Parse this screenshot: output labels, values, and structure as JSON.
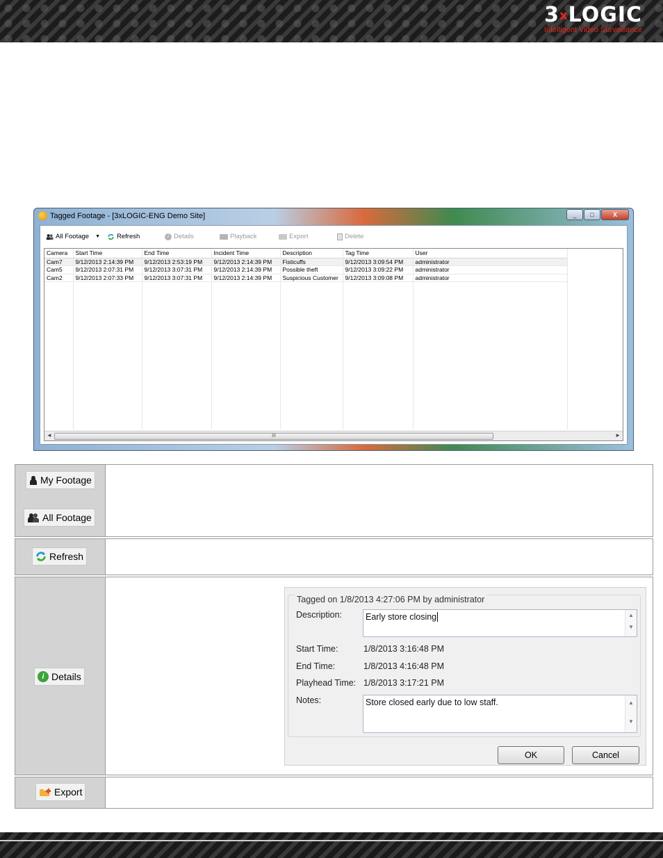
{
  "header": {
    "brand_left": "3",
    "brand_x": "x",
    "brand_right": "LOGIC",
    "tagline": "Intelligent Video Surveillance"
  },
  "window": {
    "title": "Tagged Footage - [3xLOGIC-ENG Demo Site]",
    "controls": {
      "minimize": "_",
      "maximize": "□",
      "close": "X"
    },
    "toolbar": {
      "all_footage": "All Footage",
      "refresh": "Refresh",
      "details": "Details",
      "playback": "Playback",
      "export": "Export",
      "delete": "Delete"
    },
    "columns": [
      "Camera",
      "Start Time",
      "End Time",
      "Incident Time",
      "Description",
      "Tag Time",
      "User"
    ],
    "rows": [
      [
        "Cam7",
        "9/12/2013 2:14:39 PM",
        "9/12/2013 2:53:19 PM",
        "9/12/2013 2:14:39 PM",
        "Fisticuffs",
        "9/12/2013 3:09:54 PM",
        "administrator"
      ],
      [
        "Cam5",
        "9/12/2013 2:07:31 PM",
        "9/12/2013 3:07:31 PM",
        "9/12/2013 2:14:39 PM",
        "Possible theft",
        "9/12/2013 3:09:22 PM",
        "administrator"
      ],
      [
        "Cam2",
        "9/12/2013 2:07:33 PM",
        "9/12/2013 3:07:31 PM",
        "9/12/2013 2:14:39 PM",
        "Suspicious Customer",
        "9/12/2013 3:09:08 PM",
        "administrator"
      ]
    ],
    "scroll_grip": "III"
  },
  "legend_table": {
    "my_footage": "My Footage",
    "all_footage": "All Footage",
    "refresh": "Refresh",
    "details": "Details",
    "export": "Export"
  },
  "details_dialog": {
    "group_title": "Tagged on 1/8/2013 4:27:06 PM by administrator",
    "description_label": "Description:",
    "description_value": "Early store closing",
    "start_label": "Start Time:",
    "start_value": "1/8/2013 3:16:48 PM",
    "end_label": "End Time:",
    "end_value": "1/8/2013 4:16:48 PM",
    "playhead_label": "Playhead Time:",
    "playhead_value": "1/8/2013 3:17:21 PM",
    "notes_label": "Notes:",
    "notes_value": "Store closed early due to low staff.",
    "ok": "OK",
    "cancel": "Cancel"
  },
  "colors": {
    "brand_red": "#e0281e",
    "legend_cell_gray": "#d3d3d3"
  },
  "icons": [
    "users-icon",
    "user-icon",
    "refresh-icon",
    "info-icon",
    "playback-icon",
    "export-icon",
    "delete-icon",
    "dropdown-arrow-icon"
  ]
}
